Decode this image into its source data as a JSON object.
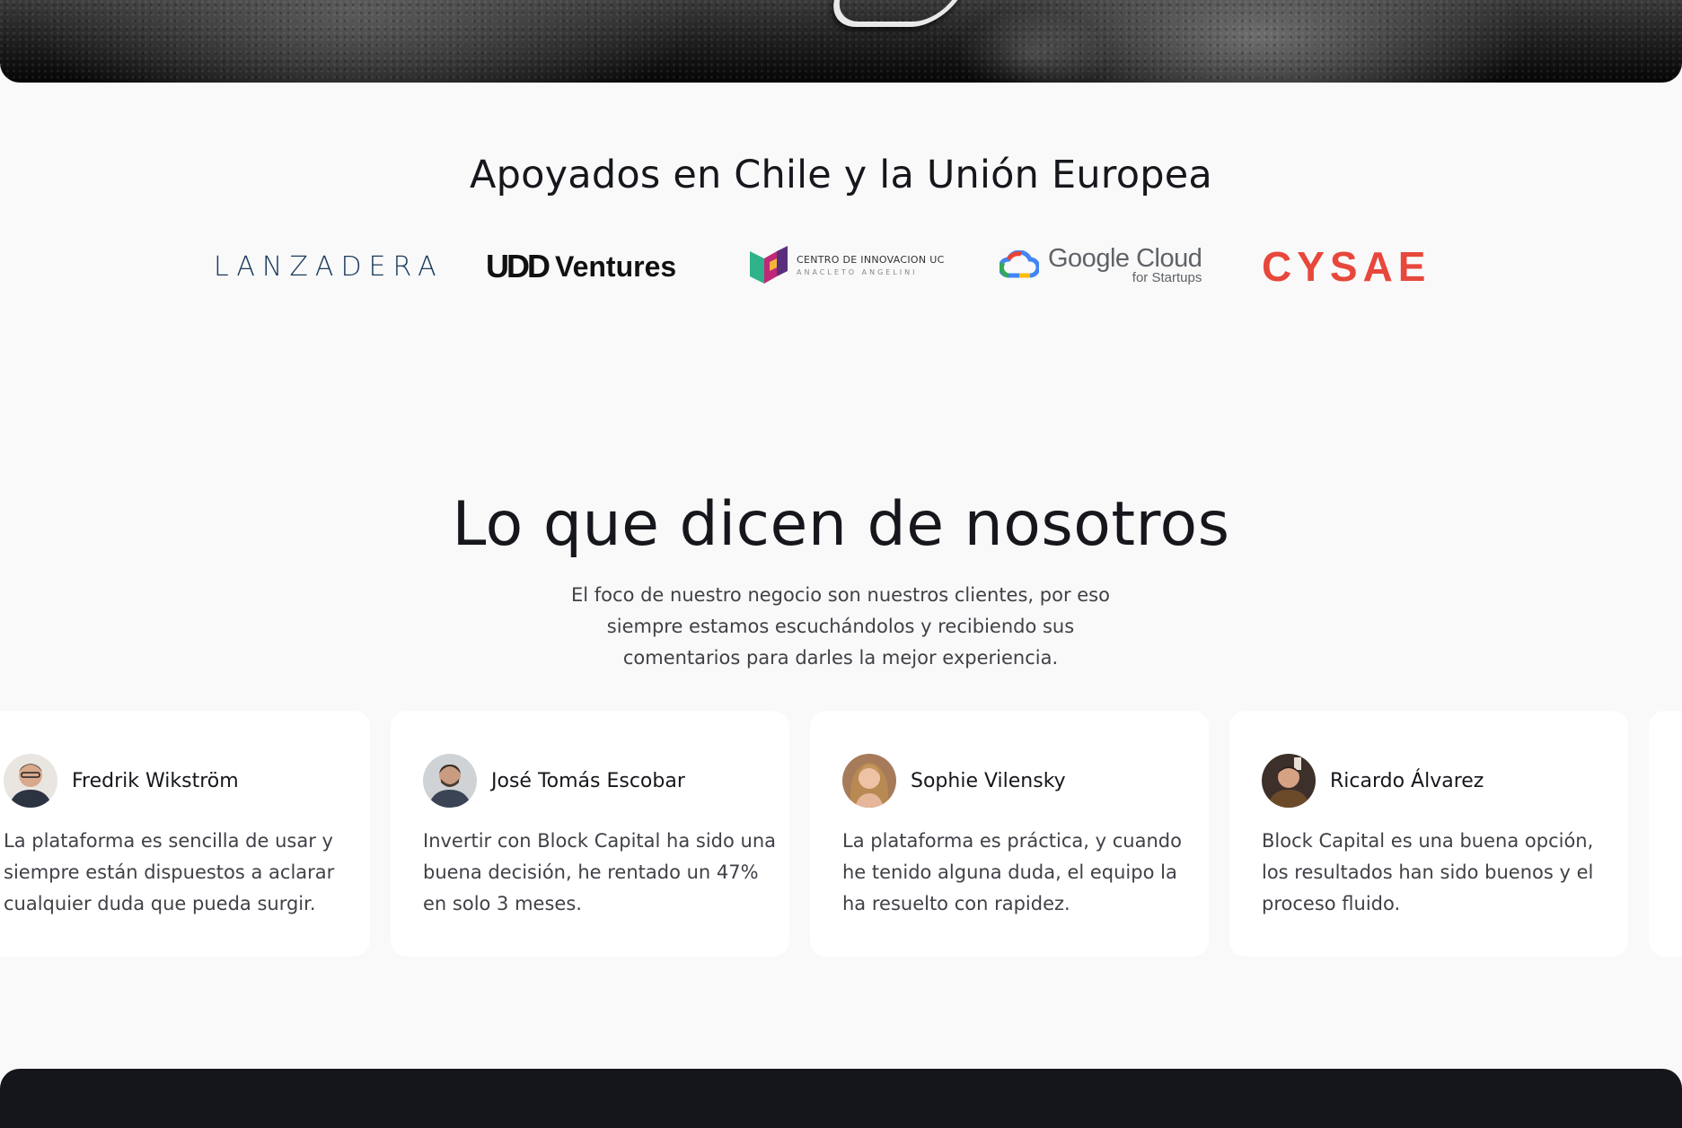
{
  "partners": {
    "title": "Apoyados en Chile y la Unión Europea",
    "logos": {
      "lanzadera": "LANZADERA",
      "udd_mark": "UDD",
      "udd_word": "Ventures",
      "uc_line1": "CENTRO DE INNOVACION UC",
      "uc_line2": "ANACLETO ANGELINI",
      "google_line1": "Google Cloud",
      "google_line2": "for Startups",
      "cysae": "CYSAE"
    }
  },
  "testimonials": {
    "title": "Lo que dicen de nosotros",
    "subtitle": "El foco de nuestro negocio son nuestros clientes, por eso siempre estamos escuchándolos y recibiendo sus comentarios para darles la mejor experiencia.",
    "items": [
      {
        "name": "Fredrik Wikström",
        "quote": "La plataforma es sencilla de usar y siempre están dispuestos a aclarar cualquier duda que pueda surgir."
      },
      {
        "name": "José Tomás Escobar",
        "quote": "Invertir con Block Capital ha sido una buena decisión, he rentado un 47% en solo 3 meses."
      },
      {
        "name": "Sophie Vilensky",
        "quote": "La plataforma es práctica, y cuando he tenido alguna duda, el equipo la ha resuelto con rapidez."
      },
      {
        "name": "Ricardo Álvarez",
        "quote": "Block Capital es una buena opción, los resultados han sido buenos y el proceso fluido."
      }
    ]
  },
  "colors": {
    "background": "#f9f9f9",
    "text": "#15171c",
    "muted_text": "#3f4147",
    "cysae_red": "#e8473b",
    "lanzadera_blue": "#1b3a5c",
    "footer_dark": "#14161b"
  }
}
